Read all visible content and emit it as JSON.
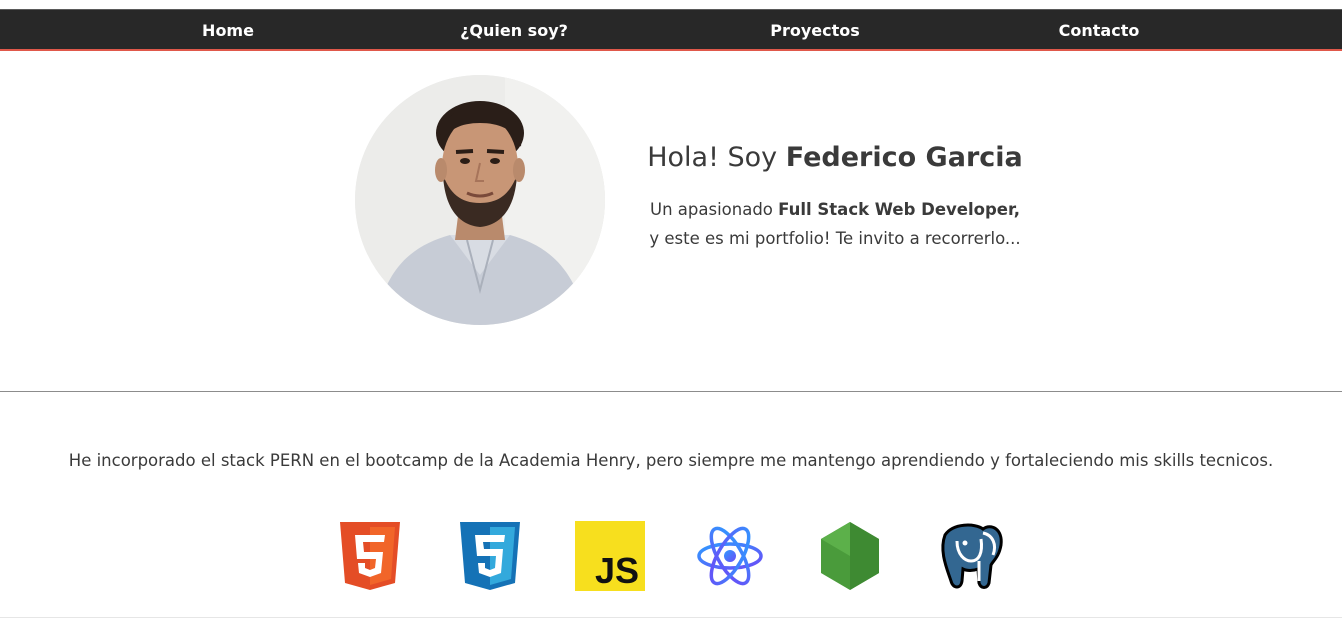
{
  "nav": {
    "items": [
      {
        "label": "Home"
      },
      {
        "label": "¿Quien soy?"
      },
      {
        "label": "Proyectos"
      },
      {
        "label": "Contacto"
      }
    ]
  },
  "hero": {
    "greeting_prefix": "Hola! Soy ",
    "name": "Federico Garcia",
    "tagline_prefix": "Un apasionado ",
    "tagline_bold": "Full Stack Web Developer,",
    "tagline_line2": "y este es mi portfolio! Te invito a recorrerlo..."
  },
  "skills": {
    "description": "He incorporado el stack PERN en el bootcamp de la Academia Henry, pero siempre me mantengo aprendiendo y fortaleciendo mis skills tecnicos.",
    "js_badge_text": "JS",
    "icons": [
      "html5-icon",
      "css3-icon",
      "javascript-icon",
      "react-icon",
      "nodejs-icon",
      "postgresql-icon"
    ]
  },
  "colors": {
    "navbar_bg": "#282828",
    "navbar_border": "#e0584a",
    "html5": "#e44d26",
    "css3": "#1572b6",
    "js": "#f7df1e",
    "react": "#3f7bf7",
    "node": "#4a9b3b",
    "postgres": "#336791"
  }
}
